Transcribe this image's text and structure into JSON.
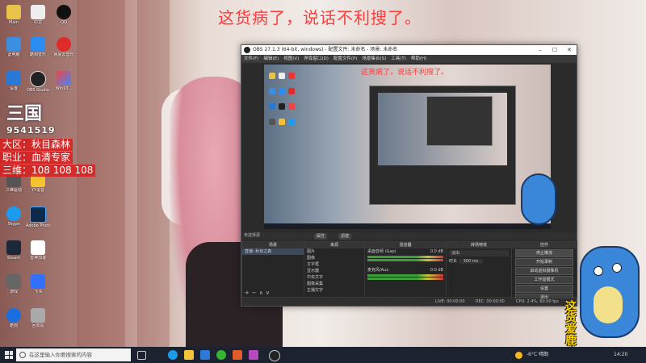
{
  "overlay": {
    "top_caption": "这货病了，说话不利搜了。",
    "logo_text": "三国",
    "logo_number": "9541519",
    "region": "大区：秋目森林",
    "job": "职业：血清专家",
    "sanwei": "三维：108 108 108",
    "mascot_caption": "这货爱鹿总"
  },
  "desktop": {
    "icons": [
      {
        "label": "Main"
      },
      {
        "label": "中文"
      },
      {
        "label": "QQ"
      },
      {
        "label": "此电脑"
      },
      {
        "label": "酷狗音乐"
      },
      {
        "label": "网易云音乐"
      },
      {
        "label": "设置"
      },
      {
        "label": "OBS Studio"
      },
      {
        "label": "Win10..."
      },
      {
        "label": "三维驱动"
      },
      {
        "label": "YY语音"
      },
      {
        "label": "Skype"
      },
      {
        "label": "Adobe Photoshop"
      },
      {
        "label": "Steam"
      },
      {
        "label": "雷神加速"
      },
      {
        "label": "游戏"
      },
      {
        "label": "飞书"
      },
      {
        "label": "酷狗"
      },
      {
        "label": "回收站"
      }
    ]
  },
  "obs": {
    "title": "OBS 27.1.3 (64-bit, windows) - 配置文件: 未命名 - 场景: 未命名",
    "menu": [
      "文件(F)",
      "编辑(E)",
      "视图(V)",
      "停靠窗口(D)",
      "配置文件(P)",
      "场景集合(S)",
      "工具(T)",
      "帮助(H)"
    ],
    "preview_caption": "这货病了，说话不利搜了。",
    "no_source": "未选择源",
    "pills": [
      "属性",
      "滤镜"
    ],
    "scenes_header": "场景",
    "scenes": [
      "直播: 秋目之森"
    ],
    "sources_header": "来源",
    "sources": [
      "图片",
      "图像",
      "文字框",
      "显示器",
      "中央文字",
      "图像采集",
      "主播文字"
    ],
    "mixer_header": "混音器",
    "mixer": [
      {
        "name": "桌面音频 (Gap)",
        "value": "0.0 dB"
      },
      {
        "name": "麦克风/Aux",
        "value": "0.0 dB"
      }
    ],
    "transitions_header": "转场特效",
    "transition_value": "淡出",
    "duration_label": "时长",
    "duration_value": "300 ms",
    "controls_header": "控件",
    "controls": [
      "停止推流",
      "开始录制",
      "启动虚拟摄像机",
      "工作室模式",
      "设置",
      "退出"
    ],
    "status": {
      "live": "LIVE: 00:00:00",
      "rec": "REC: 00:00:00",
      "cpu": "CPU: 2.4%, 60.00 fps"
    }
  },
  "taskbar": {
    "search_placeholder": "在这里输入你要搜索的内容",
    "weather": "-6°C 晴朗",
    "clock": "14:20"
  }
}
